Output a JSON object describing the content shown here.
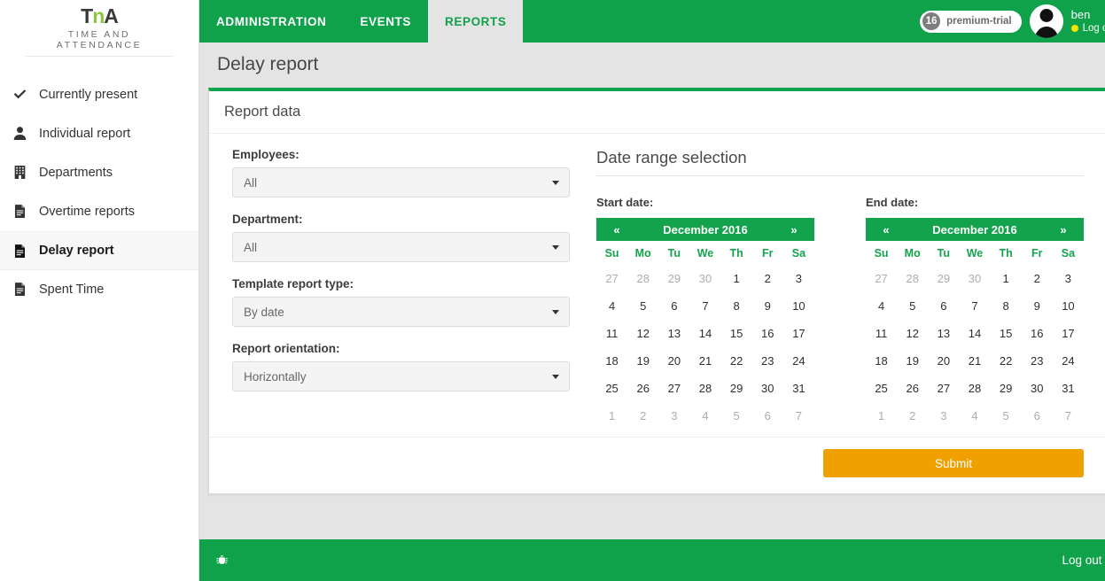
{
  "brand": {
    "logo_main": "TnA",
    "logo_t": "T",
    "logo_n": "n",
    "logo_a": "A",
    "logo_subtitle": "TIME AND ATTENDANCE"
  },
  "colors": {
    "green": "#10a24b",
    "green_dark": "#13a34c",
    "accent_orange": "#f0a000",
    "page_bg": "#e4e4e4",
    "logo_green": "#8cc63f",
    "status_dot": "#f5e400"
  },
  "sidebar": {
    "items": [
      {
        "label": "Currently present",
        "icon": "check-icon",
        "active": false
      },
      {
        "label": "Individual report",
        "icon": "user-icon",
        "active": false
      },
      {
        "label": "Departments",
        "icon": "building-icon",
        "active": false
      },
      {
        "label": "Overtime reports",
        "icon": "file-text-icon",
        "active": false
      },
      {
        "label": "Delay report",
        "icon": "file-text-icon",
        "active": true
      },
      {
        "label": "Spent Time",
        "icon": "file-text-icon",
        "active": false
      }
    ]
  },
  "topbar": {
    "tabs": [
      {
        "label": "ADMINISTRATION",
        "active": false
      },
      {
        "label": "EVENTS",
        "active": false
      },
      {
        "label": "REPORTS",
        "active": true
      }
    ],
    "plan_badge": {
      "count": "16",
      "label": "premium-trial"
    },
    "user": {
      "name": "ben",
      "logout_label": "Log out"
    }
  },
  "page": {
    "title": "Delay report",
    "panel_title": "Report data"
  },
  "form": {
    "employees": {
      "label": "Employees:",
      "value": "All"
    },
    "department": {
      "label": "Department:",
      "value": "All"
    },
    "template_report_type": {
      "label": "Template report type:",
      "value": "By date"
    },
    "report_orientation": {
      "label": "Report orientation:",
      "value": "Horizontally"
    }
  },
  "date_range": {
    "heading": "Date range selection",
    "prev_label": "«",
    "next_label": "»",
    "weekdays": [
      "Su",
      "Mo",
      "Tu",
      "We",
      "Th",
      "Fr",
      "Sa"
    ],
    "start": {
      "label": "Start date:",
      "month_title": "December 2016",
      "weeks": [
        [
          {
            "d": "27",
            "muted": true
          },
          {
            "d": "28",
            "muted": true
          },
          {
            "d": "29",
            "muted": true
          },
          {
            "d": "30",
            "muted": true
          },
          {
            "d": "1",
            "muted": false
          },
          {
            "d": "2",
            "muted": false
          },
          {
            "d": "3",
            "muted": false
          }
        ],
        [
          {
            "d": "4",
            "muted": false
          },
          {
            "d": "5",
            "muted": false
          },
          {
            "d": "6",
            "muted": false
          },
          {
            "d": "7",
            "muted": false
          },
          {
            "d": "8",
            "muted": false
          },
          {
            "d": "9",
            "muted": false
          },
          {
            "d": "10",
            "muted": false
          }
        ],
        [
          {
            "d": "11",
            "muted": false
          },
          {
            "d": "12",
            "muted": false
          },
          {
            "d": "13",
            "muted": false
          },
          {
            "d": "14",
            "muted": false
          },
          {
            "d": "15",
            "muted": false
          },
          {
            "d": "16",
            "muted": false
          },
          {
            "d": "17",
            "muted": false
          }
        ],
        [
          {
            "d": "18",
            "muted": false
          },
          {
            "d": "19",
            "muted": false
          },
          {
            "d": "20",
            "muted": false
          },
          {
            "d": "21",
            "muted": false
          },
          {
            "d": "22",
            "muted": false
          },
          {
            "d": "23",
            "muted": false
          },
          {
            "d": "24",
            "muted": false
          }
        ],
        [
          {
            "d": "25",
            "muted": false
          },
          {
            "d": "26",
            "muted": false
          },
          {
            "d": "27",
            "muted": false
          },
          {
            "d": "28",
            "muted": false
          },
          {
            "d": "29",
            "muted": false
          },
          {
            "d": "30",
            "muted": false
          },
          {
            "d": "31",
            "muted": false
          }
        ],
        [
          {
            "d": "1",
            "muted": true
          },
          {
            "d": "2",
            "muted": true
          },
          {
            "d": "3",
            "muted": true
          },
          {
            "d": "4",
            "muted": true
          },
          {
            "d": "5",
            "muted": true
          },
          {
            "d": "6",
            "muted": true
          },
          {
            "d": "7",
            "muted": true
          }
        ]
      ]
    },
    "end": {
      "label": "End date:",
      "month_title": "December 2016",
      "weeks": [
        [
          {
            "d": "27",
            "muted": true
          },
          {
            "d": "28",
            "muted": true
          },
          {
            "d": "29",
            "muted": true
          },
          {
            "d": "30",
            "muted": true
          },
          {
            "d": "1",
            "muted": false
          },
          {
            "d": "2",
            "muted": false
          },
          {
            "d": "3",
            "muted": false
          }
        ],
        [
          {
            "d": "4",
            "muted": false
          },
          {
            "d": "5",
            "muted": false
          },
          {
            "d": "6",
            "muted": false
          },
          {
            "d": "7",
            "muted": false
          },
          {
            "d": "8",
            "muted": false
          },
          {
            "d": "9",
            "muted": false
          },
          {
            "d": "10",
            "muted": false
          }
        ],
        [
          {
            "d": "11",
            "muted": false
          },
          {
            "d": "12",
            "muted": false
          },
          {
            "d": "13",
            "muted": false
          },
          {
            "d": "14",
            "muted": false
          },
          {
            "d": "15",
            "muted": false
          },
          {
            "d": "16",
            "muted": false
          },
          {
            "d": "17",
            "muted": false
          }
        ],
        [
          {
            "d": "18",
            "muted": false
          },
          {
            "d": "19",
            "muted": false
          },
          {
            "d": "20",
            "muted": false
          },
          {
            "d": "21",
            "muted": false
          },
          {
            "d": "22",
            "muted": false
          },
          {
            "d": "23",
            "muted": false
          },
          {
            "d": "24",
            "muted": false
          }
        ],
        [
          {
            "d": "25",
            "muted": false
          },
          {
            "d": "26",
            "muted": false
          },
          {
            "d": "27",
            "muted": false
          },
          {
            "d": "28",
            "muted": false
          },
          {
            "d": "29",
            "muted": false
          },
          {
            "d": "30",
            "muted": false
          },
          {
            "d": "31",
            "muted": false
          }
        ],
        [
          {
            "d": "1",
            "muted": true
          },
          {
            "d": "2",
            "muted": true
          },
          {
            "d": "3",
            "muted": true
          },
          {
            "d": "4",
            "muted": true
          },
          {
            "d": "5",
            "muted": true
          },
          {
            "d": "6",
            "muted": true
          },
          {
            "d": "7",
            "muted": true
          }
        ]
      ]
    }
  },
  "actions": {
    "submit_label": "Submit"
  },
  "footer": {
    "bug_icon": "bug-icon",
    "logout_label": "Log out",
    "logout_chevron": "»"
  }
}
